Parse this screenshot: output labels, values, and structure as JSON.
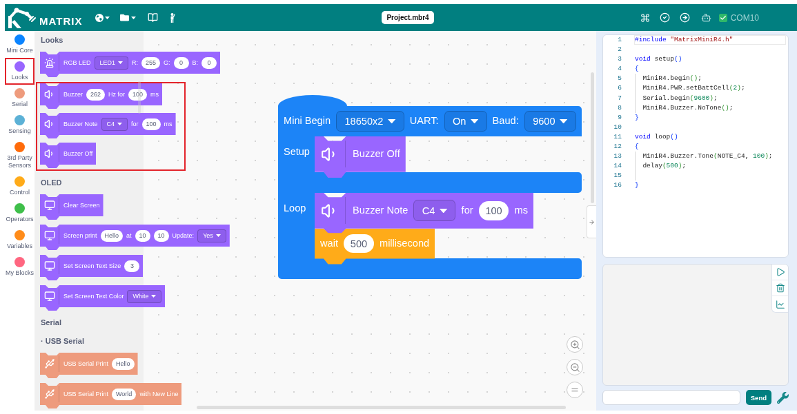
{
  "header": {
    "logo_text": "MATRIX",
    "project_name": "Project.mbr4",
    "device": {
      "connected": true,
      "port": "COM10"
    }
  },
  "categories": [
    {
      "label": "Mini Core",
      "color": "#0b84ff",
      "selected": false
    },
    {
      "label": "Looks",
      "color": "#9966ff",
      "selected": true
    },
    {
      "label": "Serial",
      "color": "#ee9b7d",
      "selected": false
    },
    {
      "label": "Sensing",
      "color": "#5cb1d6",
      "selected": false
    },
    {
      "label": "3rd Party Sensors",
      "color": "#ff6b0a",
      "selected": false
    },
    {
      "label": "Control",
      "color": "#ffab19",
      "selected": false
    },
    {
      "label": "Operators",
      "color": "#3fbf4a",
      "selected": false
    },
    {
      "label": "Variables",
      "color": "#ff8c1a",
      "selected": false
    },
    {
      "label": "My Blocks",
      "color": "#ff6680",
      "selected": false
    }
  ],
  "palette": {
    "sections": [
      {
        "title": "Looks",
        "blocks": [
          {
            "kind": "led",
            "color": "#9966ff",
            "highlighted": false,
            "parts": [
              {
                "kind": "text",
                "text": "RGB LED"
              },
              {
                "kind": "dropdown",
                "text": "LED1"
              },
              {
                "kind": "text",
                "text": "R:"
              },
              {
                "kind": "input",
                "text": "255"
              },
              {
                "kind": "text",
                "text": "G:"
              },
              {
                "kind": "input",
                "text": "0"
              },
              {
                "kind": "text",
                "text": "B:"
              },
              {
                "kind": "input",
                "text": "0"
              }
            ]
          },
          {
            "kind": "buzzer",
            "color": "#9966ff",
            "highlighted": true,
            "parts": [
              {
                "kind": "text",
                "text": "Buzzer"
              },
              {
                "kind": "input",
                "text": "262"
              },
              {
                "kind": "text",
                "text": "Hz for"
              },
              {
                "kind": "input",
                "text": "100"
              },
              {
                "kind": "text",
                "text": "ms"
              }
            ]
          },
          {
            "kind": "buzzer",
            "color": "#9966ff",
            "highlighted": true,
            "parts": [
              {
                "kind": "text",
                "text": "Buzzer Note"
              },
              {
                "kind": "dropdown",
                "text": "C4"
              },
              {
                "kind": "text",
                "text": "for"
              },
              {
                "kind": "input",
                "text": "100"
              },
              {
                "kind": "text",
                "text": "ms"
              }
            ]
          },
          {
            "kind": "buzzer",
            "color": "#9966ff",
            "highlighted": true,
            "parts": [
              {
                "kind": "text",
                "text": "Buzzer Off"
              }
            ]
          }
        ]
      },
      {
        "title": "OLED",
        "blocks": [
          {
            "kind": "display",
            "color": "#9966ff",
            "highlighted": false,
            "parts": [
              {
                "kind": "text",
                "text": "Clear Screen"
              }
            ]
          },
          {
            "kind": "display",
            "color": "#9966ff",
            "highlighted": false,
            "parts": [
              {
                "kind": "text",
                "text": "Screen print"
              },
              {
                "kind": "input",
                "text": "Hello"
              },
              {
                "kind": "text",
                "text": "at"
              },
              {
                "kind": "input",
                "text": "10"
              },
              {
                "kind": "input",
                "text": "10"
              },
              {
                "kind": "text",
                "text": "Update:"
              },
              {
                "kind": "dropdown",
                "text": "Yes"
              }
            ]
          },
          {
            "kind": "display",
            "color": "#9966ff",
            "highlighted": false,
            "parts": [
              {
                "kind": "text",
                "text": "Set Screen Text Size"
              },
              {
                "kind": "input",
                "text": "3"
              }
            ]
          },
          {
            "kind": "display",
            "color": "#9966ff",
            "highlighted": false,
            "parts": [
              {
                "kind": "text",
                "text": "Set Screen Text Color"
              },
              {
                "kind": "dropdown",
                "text": "White"
              }
            ]
          }
        ]
      },
      {
        "title": "Serial"
      },
      {
        "title": "· USB Serial",
        "blocks": [
          {
            "kind": "usb",
            "color": "#ee9b7d",
            "highlighted": false,
            "parts": [
              {
                "kind": "text",
                "text": "USB Serial Print"
              },
              {
                "kind": "input",
                "text": "Hello"
              }
            ]
          },
          {
            "kind": "usb",
            "color": "#ee9b7d",
            "highlighted": false,
            "parts": [
              {
                "kind": "text",
                "text": "USB Serial Print"
              },
              {
                "kind": "input",
                "text": "World"
              },
              {
                "kind": "text",
                "text": "with New Line"
              }
            ]
          }
        ]
      }
    ]
  },
  "workspace": {
    "script": {
      "parts": [
        {
          "kind": "text",
          "text": "Mini Begin"
        },
        {
          "kind": "dropdown",
          "text": "18650x2"
        },
        {
          "kind": "text",
          "text": "UART:"
        },
        {
          "kind": "dropdown",
          "text": "On"
        },
        {
          "kind": "text",
          "text": "Baud:"
        },
        {
          "kind": "dropdown",
          "text": "9600"
        }
      ],
      "slots": [
        {
          "label": "Setup",
          "blocks": [
            {
              "kind": "buzzer",
              "color": "#9966ff",
              "parts": [
                {
                  "kind": "text",
                  "text": "Buzzer Off"
                }
              ]
            }
          ]
        },
        {
          "label": "Loop",
          "blocks": [
            {
              "kind": "buzzer",
              "color": "#9966ff",
              "parts": [
                {
                  "kind": "text",
                  "text": "Buzzer Note"
                },
                {
                  "kind": "dropdown",
                  "text": "C4"
                },
                {
                  "kind": "text",
                  "text": "for"
                },
                {
                  "kind": "input",
                  "text": "100"
                },
                {
                  "kind": "text",
                  "text": "ms"
                }
              ]
            },
            {
              "kind": "control",
              "color": "#ffab19",
              "parts": [
                {
                  "kind": "text",
                  "text": "wait"
                },
                {
                  "kind": "input",
                  "text": "500"
                },
                {
                  "kind": "text",
                  "text": "millisecond"
                }
              ]
            }
          ]
        }
      ]
    }
  },
  "code_editor": {
    "lines": [
      {
        "number": "1",
        "current": true,
        "indented": false,
        "tokens": [
          {
            "kind": "keyword",
            "text": "#include"
          },
          {
            "kind": "string",
            "text": " \"MatrixMiniR4.h\""
          }
        ]
      },
      {
        "number": "2",
        "current": false,
        "indented": false
      },
      {
        "number": "3",
        "current": false,
        "indented": false,
        "tokens": [
          {
            "kind": "keyword",
            "text": "void"
          },
          {
            "kind": "plain",
            "text": " setup"
          },
          {
            "kind": "bracket",
            "text": "()"
          }
        ]
      },
      {
        "number": "4",
        "current": false,
        "indented": false,
        "tokens": [
          {
            "kind": "bracket",
            "text": "{"
          }
        ]
      },
      {
        "number": "5",
        "current": false,
        "indented": true,
        "tokens": [
          {
            "kind": "plain",
            "text": "MiniR4.begin"
          },
          {
            "kind": "inner",
            "text": "()"
          },
          {
            "kind": "plain",
            "text": ";"
          }
        ]
      },
      {
        "number": "6",
        "current": false,
        "indented": true,
        "tokens": [
          {
            "kind": "plain",
            "text": "MiniR4.PWR.setBattCell"
          },
          {
            "kind": "inner",
            "text": "("
          },
          {
            "kind": "number",
            "text": "2"
          },
          {
            "kind": "inner",
            "text": ")"
          },
          {
            "kind": "plain",
            "text": ";"
          }
        ]
      },
      {
        "number": "7",
        "current": false,
        "indented": true,
        "tokens": [
          {
            "kind": "plain",
            "text": "Serial.begin"
          },
          {
            "kind": "inner",
            "text": "("
          },
          {
            "kind": "number",
            "text": "9600"
          },
          {
            "kind": "inner",
            "text": ")"
          },
          {
            "kind": "plain",
            "text": ";"
          }
        ]
      },
      {
        "number": "8",
        "current": false,
        "indented": true,
        "tokens": [
          {
            "kind": "plain",
            "text": "MiniR4.Buzzer.NoTone"
          },
          {
            "kind": "inner",
            "text": "()"
          },
          {
            "kind": "plain",
            "text": ";"
          }
        ]
      },
      {
        "number": "9",
        "current": false,
        "indented": false,
        "tokens": [
          {
            "kind": "bracket",
            "text": "}"
          }
        ]
      },
      {
        "number": "10",
        "current": false,
        "indented": false
      },
      {
        "number": "11",
        "current": false,
        "indented": false,
        "tokens": [
          {
            "kind": "keyword",
            "text": "void"
          },
          {
            "kind": "plain",
            "text": " loop"
          },
          {
            "kind": "bracket",
            "text": "()"
          }
        ]
      },
      {
        "number": "12",
        "current": false,
        "indented": false,
        "tokens": [
          {
            "kind": "bracket",
            "text": "{"
          }
        ]
      },
      {
        "number": "13",
        "current": false,
        "indented": true,
        "tokens": [
          {
            "kind": "plain",
            "text": "MiniR4.Buzzer.Tone"
          },
          {
            "kind": "inner",
            "text": "("
          },
          {
            "kind": "plain",
            "text": "NOTE_C4, "
          },
          {
            "kind": "number",
            "text": "100"
          },
          {
            "kind": "inner",
            "text": ")"
          },
          {
            "kind": "plain",
            "text": ";"
          }
        ]
      },
      {
        "number": "14",
        "current": false,
        "indented": true,
        "tokens": [
          {
            "kind": "plain",
            "text": "delay"
          },
          {
            "kind": "inner",
            "text": "("
          },
          {
            "kind": "number",
            "text": "500"
          },
          {
            "kind": "inner",
            "text": ")"
          },
          {
            "kind": "plain",
            "text": ";"
          }
        ]
      },
      {
        "number": "15",
        "current": false,
        "indented": true
      },
      {
        "number": "16",
        "current": false,
        "indented": false,
        "tokens": [
          {
            "kind": "bracket",
            "text": "}"
          }
        ]
      }
    ]
  },
  "serial_monitor": {
    "send_label": "Send"
  }
}
